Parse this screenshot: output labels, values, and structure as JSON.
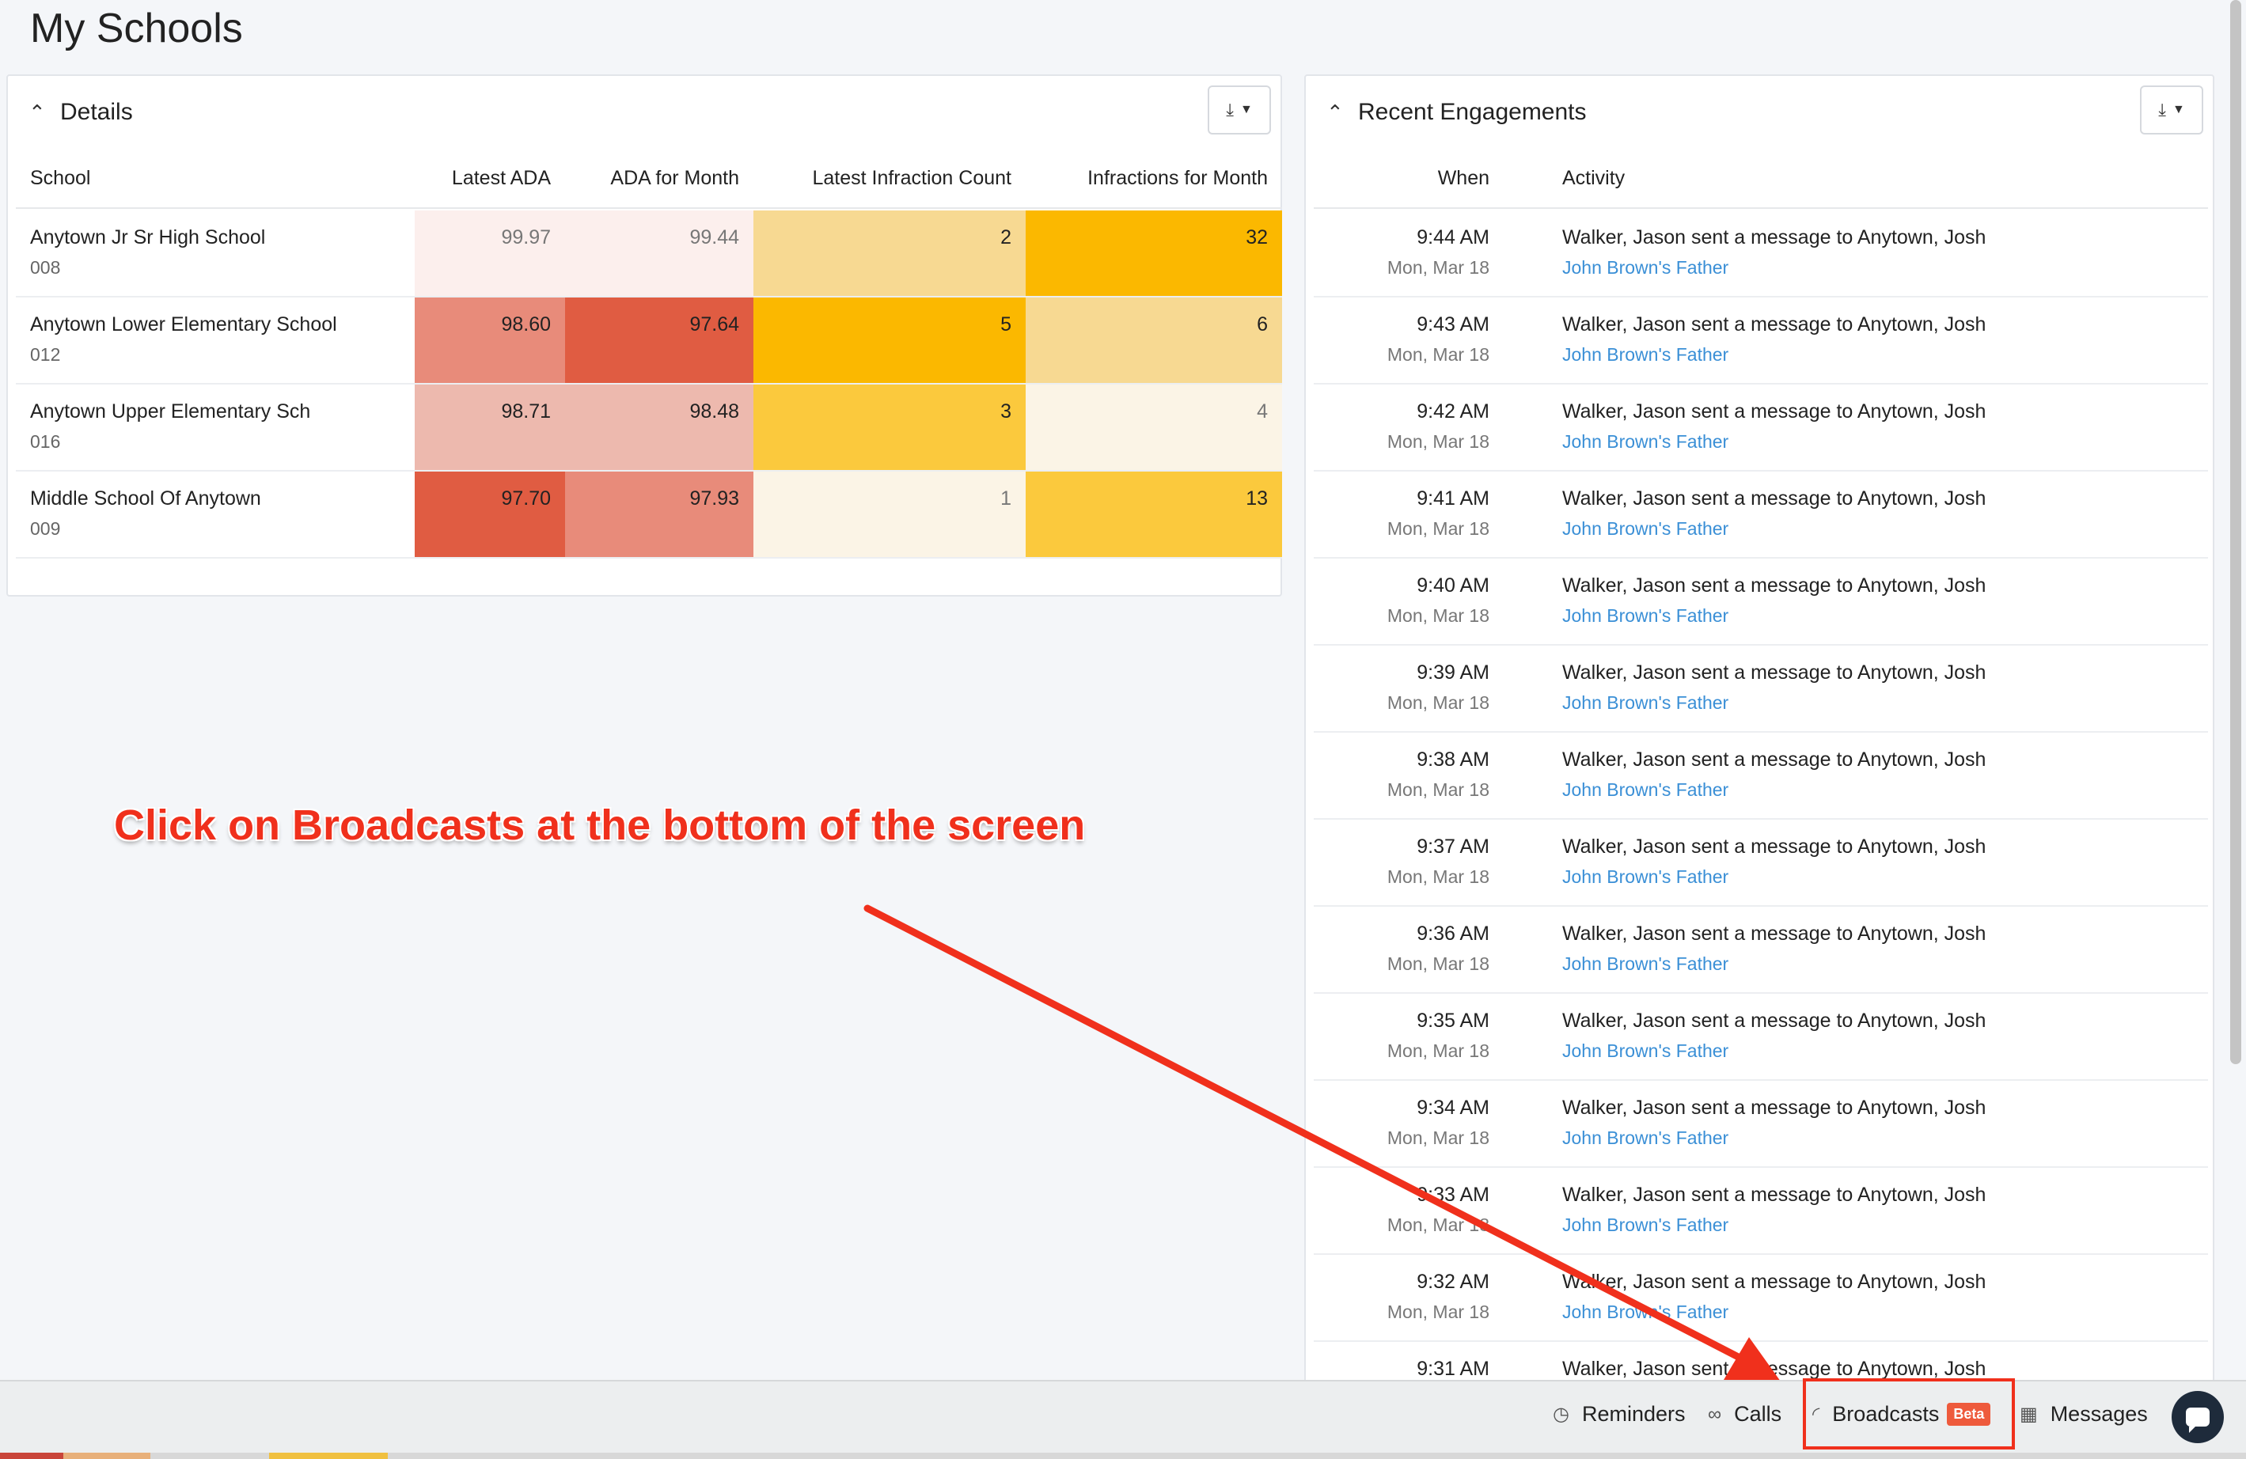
{
  "page": {
    "title": "My Schools"
  },
  "details": {
    "title": "Details",
    "columns": [
      "School",
      "Latest ADA",
      "ADA for Month",
      "Latest Infraction Count",
      "Infractions for Month"
    ],
    "rows": [
      {
        "name": "Anytown Jr Sr High School",
        "code": "008",
        "latest_ada": "99.97",
        "ada_month": "99.44",
        "latest_inf": "2",
        "inf_month": "32",
        "colors": [
          "#fcefed",
          "#fcefed",
          "#f7d992",
          "#fbb800"
        ]
      },
      {
        "name": "Anytown Lower Elementary School",
        "code": "012",
        "latest_ada": "98.60",
        "ada_month": "97.64",
        "latest_inf": "5",
        "inf_month": "6",
        "colors": [
          "#e88b7a",
          "#e05c42",
          "#fbb800",
          "#f7d992"
        ]
      },
      {
        "name": "Anytown Upper Elementary Sch",
        "code": "016",
        "latest_ada": "98.71",
        "ada_month": "98.48",
        "latest_inf": "3",
        "inf_month": "4",
        "colors": [
          "#edb9ae",
          "#edb9ae",
          "#fbc93d",
          "#fbf4e6"
        ]
      },
      {
        "name": "Middle School Of Anytown",
        "code": "009",
        "latest_ada": "97.70",
        "ada_month": "97.93",
        "latest_inf": "1",
        "inf_month": "13",
        "colors": [
          "#e05c42",
          "#e88b7a",
          "#fbf4e6",
          "#fbc93d"
        ]
      }
    ]
  },
  "engagements": {
    "title": "Recent Engagements",
    "columns": {
      "when": "When",
      "activity": "Activity"
    },
    "rows": [
      {
        "time": "9:44 AM",
        "date": "Mon, Mar 18",
        "msg": "Walker, Jason sent a message to Anytown, Josh",
        "who": "John Brown's Father"
      },
      {
        "time": "9:43 AM",
        "date": "Mon, Mar 18",
        "msg": "Walker, Jason sent a message to Anytown, Josh",
        "who": "John Brown's Father"
      },
      {
        "time": "9:42 AM",
        "date": "Mon, Mar 18",
        "msg": "Walker, Jason sent a message to Anytown, Josh",
        "who": "John Brown's Father"
      },
      {
        "time": "9:41 AM",
        "date": "Mon, Mar 18",
        "msg": "Walker, Jason sent a message to Anytown, Josh",
        "who": "John Brown's Father"
      },
      {
        "time": "9:40 AM",
        "date": "Mon, Mar 18",
        "msg": "Walker, Jason sent a message to Anytown, Josh",
        "who": "John Brown's Father"
      },
      {
        "time": "9:39 AM",
        "date": "Mon, Mar 18",
        "msg": "Walker, Jason sent a message to Anytown, Josh",
        "who": "John Brown's Father"
      },
      {
        "time": "9:38 AM",
        "date": "Mon, Mar 18",
        "msg": "Walker, Jason sent a message to Anytown, Josh",
        "who": "John Brown's Father"
      },
      {
        "time": "9:37 AM",
        "date": "Mon, Mar 18",
        "msg": "Walker, Jason sent a message to Anytown, Josh",
        "who": "John Brown's Father"
      },
      {
        "time": "9:36 AM",
        "date": "Mon, Mar 18",
        "msg": "Walker, Jason sent a message to Anytown, Josh",
        "who": "John Brown's Father"
      },
      {
        "time": "9:35 AM",
        "date": "Mon, Mar 18",
        "msg": "Walker, Jason sent a message to Anytown, Josh",
        "who": "John Brown's Father"
      },
      {
        "time": "9:34 AM",
        "date": "Mon, Mar 18",
        "msg": "Walker, Jason sent a message to Anytown, Josh",
        "who": "John Brown's Father"
      },
      {
        "time": "9:33 AM",
        "date": "Mon, Mar 18",
        "msg": "Walker, Jason sent a message to Anytown, Josh",
        "who": "John Brown's Father"
      },
      {
        "time": "9:32 AM",
        "date": "Mon, Mar 18",
        "msg": "Walker, Jason sent a message to Anytown, Josh",
        "who": "John Brown's Father"
      },
      {
        "time": "9:31 AM",
        "date": "",
        "msg": "Walker, Jason sent a message to Anytown, Josh",
        "who": ""
      }
    ]
  },
  "annotation": {
    "text": "Click on Broadcasts at the bottom of the screen",
    "color": "#f0301c"
  },
  "bottombar": {
    "reminders": "Reminders",
    "calls": "Calls",
    "broadcasts": "Broadcasts",
    "beta": "Beta",
    "messages": "Messages",
    "icons": {
      "reminders": "clock-icon",
      "calls": "voicemail-icon",
      "broadcasts": "megaphone-icon",
      "messages": "chat-icon"
    }
  }
}
